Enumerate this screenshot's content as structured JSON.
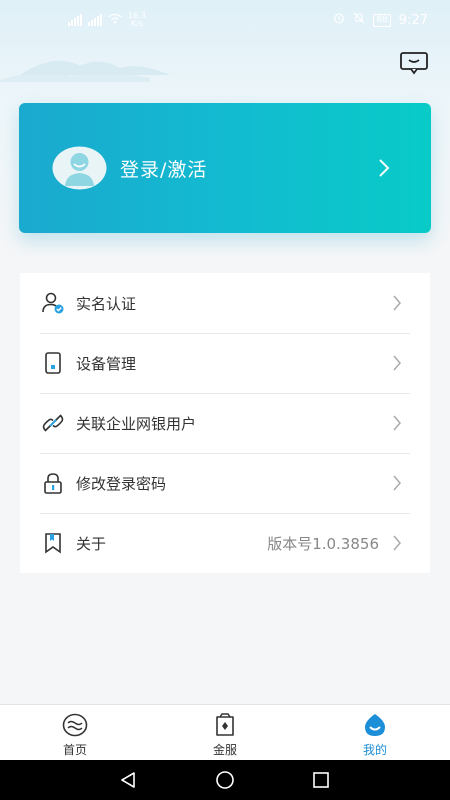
{
  "status_bar": {
    "speed_value": "16.3",
    "speed_unit": "K/s",
    "battery": "88",
    "time": "9:27"
  },
  "login_card": {
    "label": "登录/激活"
  },
  "menu": {
    "items": [
      {
        "label": "实名认证",
        "icon": "user-verified-icon"
      },
      {
        "label": "设备管理",
        "icon": "phone-device-icon"
      },
      {
        "label": "关联企业网银用户",
        "icon": "link-icon"
      },
      {
        "label": "修改登录密码",
        "icon": "lock-icon"
      },
      {
        "label": "关于",
        "icon": "bookmark-icon",
        "value": "版本号1.0.3856"
      }
    ]
  },
  "bottom_nav": {
    "items": [
      {
        "label": "首页",
        "icon": "home-icon"
      },
      {
        "label": "金服",
        "icon": "finance-icon"
      },
      {
        "label": "我的",
        "icon": "me-icon"
      }
    ],
    "active": "我的"
  },
  "colors": {
    "accent": "#1c8fd8",
    "card_start": "#1aa9cf",
    "card_end": "#08cbc7"
  }
}
